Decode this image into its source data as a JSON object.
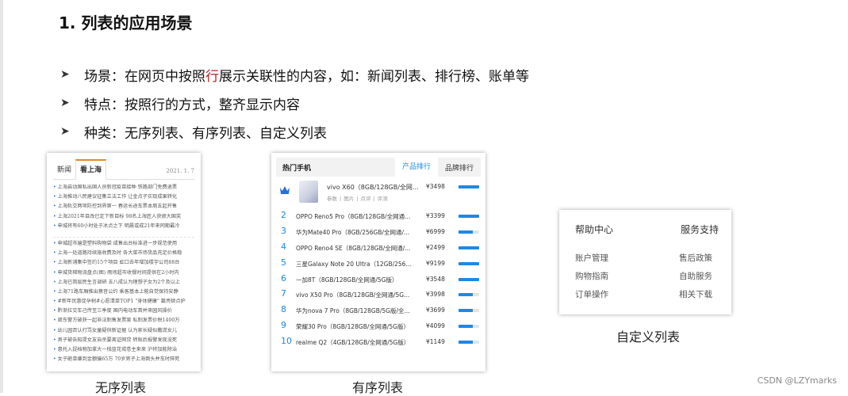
{
  "title": "1. 列表的应用场景",
  "bullets": [
    {
      "prefix": "场景：在网页中按照",
      "highlight": "行",
      "suffix": "展示关联性的内容，如：新闻列表、排行榜、账单等"
    },
    {
      "prefix": "特点：按照行的方式，整齐显示内容",
      "highlight": "",
      "suffix": ""
    },
    {
      "prefix": "种类：无序列表、有序列表、自定义列表",
      "highlight": "",
      "suffix": ""
    }
  ],
  "unordered": {
    "caption": "无序列表",
    "tabs": [
      "新闻",
      "看上海"
    ],
    "date": "2021. 1. 7",
    "groups": [
      [
        "上海启动国私出国人员新冠疫苗接种 铁路部门免费退票",
        "上海推动八民建议征集立法工作 让金点子实现成果转化",
        "上海轨交两项防控到界第一 春运长途车票本周五起开售",
        "上海2021年目改已定下新目标 98名上海匠人获颁大国奖",
        "申城将有60小时处于冰点之下 明晨或成21年来同期最冷"
      ],
      [
        "申城超市遍是塑料购物袋 成售出台标准进一步规范使用",
        "上海一处道路持续施收费及时 各大菜市场货品充足价格稳",
        "上海新浦集中签约15个项目 虹口去年增加楼宇公司88台",
        "申城货梯物流盘点(图) 雨场超市收餐时间提供在2小时内",
        "上海已简层民生言调研 五八成认为理想子女为2个及以上",
        "上海71路车厢推出蔡音公约 乘客基本上能自觉保持安静",
        "#新年优惠促孕树#心愿清单TOP1 \"身体健康\" 篇亮顿点护",
        "黔渐拉交车己传至三季度 国内电动车首并来园风操价",
        "疏东警方破获一起非法制售发票案 私制发票价税1400万",
        "幼儿园否认打骂女童疑供新证据 认为家长疑似撒谎女儿",
        "男子被告知提女友自杀要离证网贷 转账后报警发现没死",
        "惠托入捉档物加拿大一栈蓝花戒卷主来来 沪将加能除治",
        "女子砸单嫌到金额骗65万 70岁男子上海倒头并车时猝死"
      ]
    ]
  },
  "ordered": {
    "caption": "有序列表",
    "header": "热门手机",
    "tabs": [
      "产品排行",
      "品牌排行"
    ],
    "top": {
      "name": "vivo X60（8GB/128GB/全网...",
      "links": [
        "参数",
        "|",
        "图片",
        "|",
        "点评",
        "|",
        "评测"
      ],
      "price": "¥3498",
      "level": 1.0
    },
    "rows": [
      {
        "num": "2",
        "name": "OPPO Reno5 Pro（8GB/128GB/全网通...",
        "price": "¥3399",
        "level": 1.0
      },
      {
        "num": "3",
        "name": "华为Mate40 Pro（8GB/256GB/全网通/...",
        "price": "¥6999",
        "level": 0.7
      },
      {
        "num": "4",
        "name": "OPPO Reno4 SE（8GB/128GB/全网通/...",
        "price": "¥2499",
        "level": 1.0
      },
      {
        "num": "5",
        "name": "三星Galaxy Note 20 Ultra（12GB/256G...",
        "price": "¥9199",
        "level": 1.0
      },
      {
        "num": "6",
        "name": "一加8T（8GB/128GB/全网通/5G版）",
        "price": "¥3548",
        "level": 1.0
      },
      {
        "num": "7",
        "name": "vivo X50 Pro（8GB/128GB/全网通/5G...",
        "price": "¥3998",
        "level": 0.7
      },
      {
        "num": "8",
        "name": "华为nova 7 Pro（8GB/128GB/5G版/全...",
        "price": "¥3699",
        "level": 0.7
      },
      {
        "num": "9",
        "name": "荣耀30 Pro（8GB/128GB/全网通/5G版）",
        "price": "¥4099",
        "level": 0.7
      },
      {
        "num": "10",
        "name": "realme Q2（4GB/128GB/全网通/5G版）",
        "price": "¥1149",
        "level": 0.7
      }
    ]
  },
  "custom": {
    "caption": "自定义列表",
    "headers": [
      "帮助中心",
      "服务支持"
    ],
    "rows": [
      [
        "账户管理",
        "售后政策"
      ],
      [
        "购物指南",
        "自助服务"
      ],
      [
        "订单操作",
        "相关下载"
      ]
    ]
  },
  "watermark": "CSDN @LZYmarks",
  "colors": {
    "accent_blue": "#1e88e5",
    "highlight_red": "#b22222",
    "tab_orange": "#e08a2a",
    "crown_blue": "#2a6fd6"
  }
}
